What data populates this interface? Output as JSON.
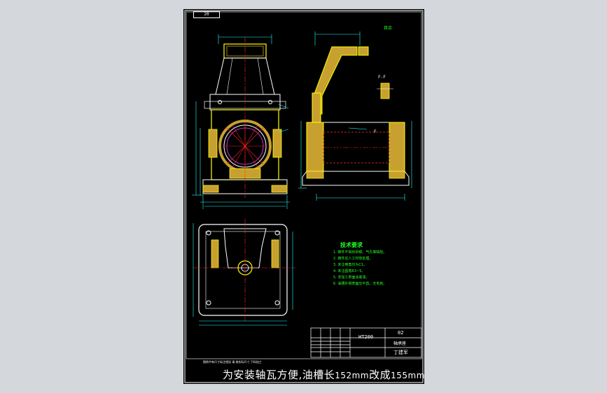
{
  "drawing": {
    "corner_tag": "20",
    "roughness_note": "其余",
    "section_label": "F-F",
    "section_marker": "F",
    "material": "HT200",
    "part_number": "02",
    "part_name": "轴承座",
    "designer": "丁建军",
    "caption_cn1": "为安装轴瓦方便,油槽长",
    "caption_v1": "152mm",
    "caption_cn2": "改成",
    "caption_v2": "155mm",
    "small_print": "图纸中有尺寸标注错误  请  按实际尺寸  下料加工"
  },
  "colors": {
    "background": "#d4d8dc",
    "sheet": "#000000",
    "outline": "#ffffff",
    "body": "#ffff00",
    "section_fill": "#c8a030",
    "center": "#ff2020",
    "hidden": "#ff3030",
    "dimension": "#20ffff",
    "text_green": "#23ff23",
    "pink": "#ff40ff"
  },
  "notes": {
    "title": "技术要求",
    "items": [
      "1. 铸件不得有砂眼、气孔等缺陷。",
      "2. 铸件应人工时效处理。",
      "3. 未注倒角均为C1。",
      "4. 未注圆角R3~5。",
      "5. 非加工表面涂底漆。",
      "6. 油槽外侧表面应平直，无毛刺。"
    ]
  }
}
